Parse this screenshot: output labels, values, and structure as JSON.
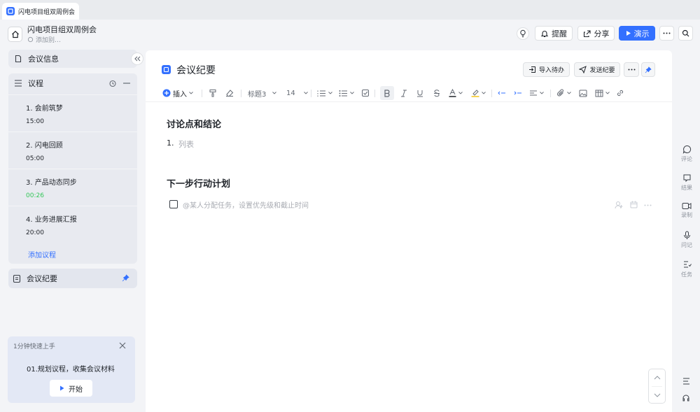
{
  "tab": {
    "label": "闪电项目组双周例会"
  },
  "header": {
    "title": "闪电项目组双周例会",
    "subtitle": "添加别…",
    "buttons": {
      "remind": "提醒",
      "share": "分享",
      "present": "演示"
    }
  },
  "sidebar": {
    "meeting_info": "会议信息",
    "agenda_title": "议程",
    "agenda": [
      {
        "title": "1. 会前筑梦",
        "time": "15:00"
      },
      {
        "title": "2. 闪电回顾",
        "time": "05:00"
      },
      {
        "title": "3. 产品动态同步",
        "time": "00:26"
      },
      {
        "title": "4. 业务进展汇报",
        "time": "20:00"
      }
    ],
    "add_agenda": "添加议程",
    "notes": "会议纪要",
    "quickstart": {
      "title": "1分钟快速上手",
      "step": "01.规划议程，收集会议材料",
      "start": "开始"
    }
  },
  "doc": {
    "title": "会议纪要",
    "import_label": "导入待办",
    "send_label": "发送纪要",
    "toolbar": {
      "insert": "插入",
      "heading": "标题3",
      "font_size": "14"
    },
    "sections": [
      {
        "heading": "讨论点和结论",
        "list_number": "1.",
        "placeholder": "列表"
      },
      {
        "heading": "下一步行动计划",
        "task_placeholder": "@某人分配任务，设置优先级和截止时间"
      }
    ]
  },
  "right_rail": [
    "评论",
    "结果",
    "录制",
    "问记",
    "任务"
  ],
  "colors": {
    "accent": "#3370ff",
    "green_time": "#34c759"
  }
}
